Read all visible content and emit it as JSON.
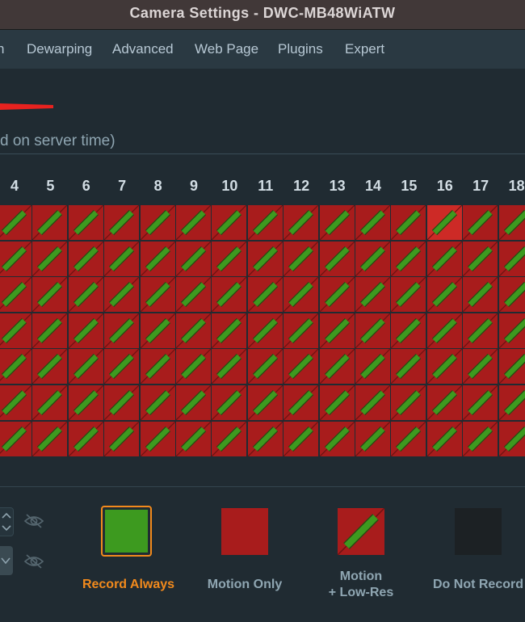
{
  "window": {
    "title": "Camera Settings - DWC-MB48WiATW"
  },
  "tabs": [
    {
      "label": "n"
    },
    {
      "label": "Dewarping"
    },
    {
      "label": "Advanced"
    },
    {
      "label": "Web Page"
    },
    {
      "label": "Plugins"
    },
    {
      "label": "Expert"
    }
  ],
  "schedule": {
    "subtitle": "d on server time)",
    "hours": [
      "4",
      "5",
      "6",
      "7",
      "8",
      "9",
      "10",
      "11",
      "12",
      "13",
      "14",
      "15",
      "16",
      "17",
      "18"
    ],
    "rows": 7,
    "cell_mode": "motion-low-res",
    "highlighted_hour": "16",
    "highlighted_row": 1
  },
  "legend": {
    "items": [
      {
        "label": "Record Always",
        "selected": true
      },
      {
        "label": "Motion Only",
        "selected": false
      },
      {
        "label_line1": "Motion",
        "label_line2": "+ Low-Res",
        "selected": false
      },
      {
        "label": "Do Not Record",
        "selected": false
      }
    ]
  },
  "colors": {
    "record_always": "#3d9a1f",
    "motion_only": "#a81c1c",
    "do_not_record": "#1c2124",
    "selected_accent": "#f28a1c",
    "inactive_label": "#8fa6b2",
    "slider": "#e8221f"
  },
  "icons": {
    "hidden_toggle_1": "eye-slash-icon",
    "hidden_toggle_2": "eye-slash-icon",
    "spin_up": "chevron-up-icon",
    "spin_down": "chevron-down-icon",
    "combo": "chevron-down-icon"
  }
}
